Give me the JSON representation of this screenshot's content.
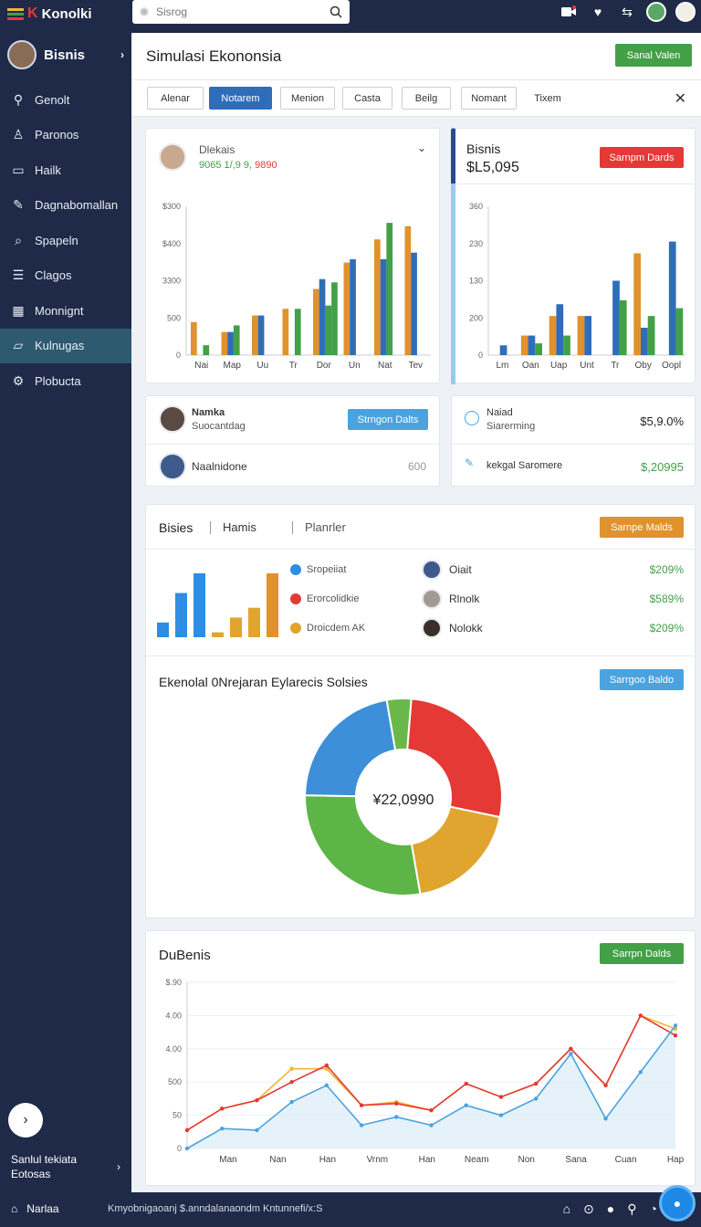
{
  "topbar": {
    "brand": "Konolki",
    "search_placeholder": "Sisrog",
    "icons": [
      "hamburger-icon",
      "video-icon",
      "heart-icon",
      "swap-icon",
      "avatar",
      "avatar"
    ]
  },
  "sidebar": {
    "user": "Bisnis",
    "items": [
      {
        "label": "Genolt",
        "icon": "share-icon"
      },
      {
        "label": "Paronos",
        "icon": "user-icon"
      },
      {
        "label": "Hailk",
        "icon": "folder-icon"
      },
      {
        "label": "Dagnabomallan",
        "icon": "pencil-icon"
      },
      {
        "label": "Spapeln",
        "icon": "search-icon"
      },
      {
        "label": "Clagos",
        "icon": "list-icon"
      },
      {
        "label": "Monnignt",
        "icon": "calendar-icon"
      },
      {
        "label": "Kulnugas",
        "icon": "map-icon"
      },
      {
        "label": "Plobucta",
        "icon": "gear-icon"
      }
    ],
    "footer_line1": "Sanlul tekiata",
    "footer_line2": "Eotosas"
  },
  "main": {
    "title": "Simulasi Ekononsia",
    "title_button": "Sanal Valen",
    "tabs": [
      "Alenar",
      "Notarem",
      "Menion",
      "Casta",
      "Beilg",
      "Nomant",
      "Tixem"
    ],
    "active_tab": "Notarem"
  },
  "card1": {
    "name": "Dlekais",
    "sub_green": "9065 1/​,9 9,",
    "sub_red": "9890",
    "chart_data": {
      "type": "bar",
      "categories": [
        "Nai",
        "Map",
        "Uu",
        "Tr",
        "Dor",
        "Un",
        "Nat",
        "Tev"
      ],
      "ytick_labels": [
        "0",
        "500",
        "3300",
        "$400",
        "$300"
      ],
      "series": [
        {
          "color": "#e0922e",
          "values": [
            1.0,
            0.7,
            1.2,
            1.4,
            2.0,
            2.8,
            3.5,
            3.9
          ]
        },
        {
          "color": "#2f6db8",
          "values": [
            0.0,
            0.7,
            1.2,
            0.0,
            2.3,
            2.9,
            2.9,
            3.1
          ]
        },
        {
          "color": "#43a047",
          "values": [
            0.3,
            0.9,
            0.0,
            1.4,
            1.5,
            0.0,
            4.0,
            0.0
          ]
        },
        {
          "color": "#43a047",
          "values": [
            0.0,
            0.0,
            0.0,
            0.0,
            2.2,
            0.0,
            0.0,
            0.0
          ]
        }
      ],
      "ylim": [
        0,
        4.5
      ]
    }
  },
  "card2": {
    "title": "Bisnis",
    "amount": "$L5,095",
    "button": "Sarnpm Dards",
    "chart_data": {
      "type": "bar",
      "categories": [
        "Lm",
        "Oan",
        "Uap",
        "Unt",
        "Tr",
        "Oby",
        "Oopl"
      ],
      "ytick_labels": [
        "0",
        "200",
        "130",
        "230",
        "360"
      ],
      "series": [
        {
          "color": "#e0922e",
          "values": [
            0.0,
            0.5,
            1.0,
            1.0,
            0.0,
            2.6,
            0.0
          ]
        },
        {
          "color": "#2f6db8",
          "values": [
            0.25,
            0.5,
            1.3,
            1.0,
            1.9,
            0.7,
            2.9
          ]
        },
        {
          "color": "#43a047",
          "values": [
            0.0,
            0.3,
            0.5,
            0.0,
            1.4,
            1.0,
            1.2
          ]
        }
      ],
      "ylim": [
        0,
        3.8
      ]
    }
  },
  "card3": {
    "person1_name": "Namka",
    "person1_sub": "Suocantdag",
    "button": "Strngon Dalts",
    "person2_name": "Naalnidone",
    "person2_value": "600"
  },
  "card4": {
    "row1_label": "Naiad",
    "row1_sub": "Siarerming",
    "row1_value": "$5,9.0%",
    "row2_label": "kekgal Saromere",
    "row2_value": "$,20995"
  },
  "card5": {
    "tabs": [
      "Bisies",
      "Hamis",
      "Planrler"
    ],
    "button": "Sarnpe Malds",
    "mini_chart_data": {
      "type": "bar",
      "values": [
        0.3,
        0.9,
        1.3,
        0.1,
        0.4,
        0.6,
        1.3
      ],
      "colors": [
        "#2f8de4",
        "#2f8de4",
        "#2f8de4",
        "#e0a52e",
        "#e0a52e",
        "#e0a52e",
        "#e0922e"
      ]
    },
    "legend": [
      {
        "label": "Sropeiiat",
        "color": "#2f8de4"
      },
      {
        "label": "Erorcolidkie",
        "color": "#e53935"
      },
      {
        "label": "Droicdem AK",
        "color": "#e0a52e"
      }
    ],
    "people": [
      {
        "name": "Oiait",
        "value": "$209%"
      },
      {
        "name": "Rlnolk",
        "value": "$589%"
      },
      {
        "name": "Nolokk",
        "value": "$209%"
      }
    ],
    "donut_title": "Ekenolal 0Nrejaran Eylarecis Solsies",
    "donut_button": "Sarrgoo Baldo",
    "donut_center": "¥22,0990",
    "chart_data": {
      "type": "pie",
      "slices": [
        {
          "color": "#e53935",
          "value": 27
        },
        {
          "color": "#e0a52e",
          "value": 19
        },
        {
          "color": "#5cb546",
          "value": 28
        },
        {
          "color": "#3d8fd9",
          "value": 22
        },
        {
          "color": "#6bb84a",
          "value": 4
        }
      ]
    }
  },
  "card6": {
    "title": "DuBenis",
    "button": "Sarrpn Dalds",
    "chart_data": {
      "type": "line",
      "x": [
        "Man",
        "Nan",
        "Han",
        "Vrnm",
        "Han",
        "Neam",
        "Non",
        "Sana",
        "Cuan",
        "Hap"
      ],
      "ytick_labels": [
        "0",
        "50",
        "500",
        "4.00",
        "4.00",
        "$.90"
      ],
      "series": [
        {
          "color": "#f2b632",
          "values": [
            0.55,
            1.2,
            1.45,
            2.4,
            2.4,
            1.3,
            1.4,
            1.15,
            1.95,
            1.55,
            1.95,
            3.0,
            1.9,
            4.0,
            3.6
          ]
        },
        {
          "color": "#e53935",
          "values": [
            0.55,
            1.2,
            1.45,
            2.0,
            2.5,
            1.3,
            1.35,
            1.15,
            1.95,
            1.55,
            1.95,
            3.0,
            1.9,
            4.0,
            3.4
          ]
        },
        {
          "color": "#4aa3df",
          "values": [
            0.0,
            0.6,
            0.55,
            1.4,
            1.9,
            0.7,
            0.95,
            0.7,
            1.3,
            1.0,
            1.5,
            2.85,
            0.9,
            2.3,
            3.7
          ]
        }
      ],
      "ylim": [
        0,
        5
      ]
    }
  },
  "bottombar": {
    "label": "Narlaa",
    "text": "Kmyobnigaoanj $.anndalanaondm Kntunnefi/x:S"
  }
}
